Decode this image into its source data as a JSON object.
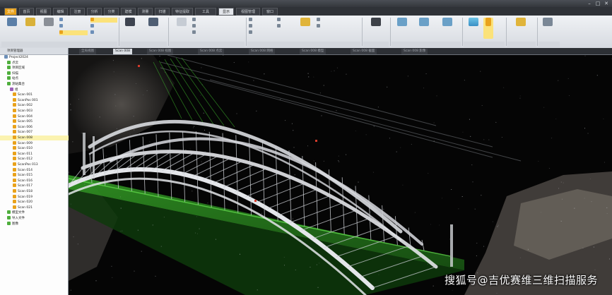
{
  "window": {
    "title": "",
    "controls": [
      "–",
      "□",
      "✕"
    ]
  },
  "ribbon_tabs": [
    {
      "label": "文件",
      "state": "file"
    },
    {
      "label": "首页",
      "state": "normal"
    },
    {
      "label": "视图",
      "state": "normal"
    },
    {
      "label": "编辑",
      "state": "normal"
    },
    {
      "label": "注册",
      "state": "normal"
    },
    {
      "label": "分析",
      "state": "normal"
    },
    {
      "label": "分类",
      "state": "normal"
    },
    {
      "label": "建模",
      "state": "normal"
    },
    {
      "label": "测量",
      "state": "normal"
    },
    {
      "label": "扫描",
      "state": "normal"
    },
    {
      "label": "特征提取",
      "state": "normal"
    },
    {
      "label": "工具",
      "state": "normal"
    },
    {
      "label": "显示",
      "state": "active"
    },
    {
      "label": "视图管理",
      "state": "normal"
    },
    {
      "label": "窗口",
      "state": "normal"
    }
  ],
  "tree": {
    "header": "项目管理器",
    "nodes": [
      {
        "label": "Project2024",
        "depth": 1,
        "selected": false
      },
      {
        "label": "点云",
        "depth": 2,
        "selected": false
      },
      {
        "label": "项目区域",
        "depth": 2,
        "selected": false
      },
      {
        "label": "扫描",
        "depth": 2,
        "selected": false
      },
      {
        "label": "站点",
        "depth": 2,
        "selected": false
      },
      {
        "label": "测站集合",
        "depth": 2,
        "selected": false
      },
      {
        "label": "组",
        "depth": 3,
        "selected": false
      },
      {
        "label": "Scan 001",
        "depth": 4,
        "selected": false
      },
      {
        "label": "ScanPos 001",
        "depth": 4,
        "selected": false
      },
      {
        "label": "Scan 002",
        "depth": 4,
        "selected": false
      },
      {
        "label": "Scan 003",
        "depth": 4,
        "selected": false
      },
      {
        "label": "Scan 004",
        "depth": 4,
        "selected": false
      },
      {
        "label": "Scan 005",
        "depth": 4,
        "selected": false
      },
      {
        "label": "Scan 006",
        "depth": 4,
        "selected": false
      },
      {
        "label": "Scan 007",
        "depth": 4,
        "selected": false
      },
      {
        "label": "Scan 008",
        "depth": 4,
        "selected": true
      },
      {
        "label": "Scan 009",
        "depth": 4,
        "selected": false
      },
      {
        "label": "Scan 010",
        "depth": 4,
        "selected": false
      },
      {
        "label": "Scan 011",
        "depth": 4,
        "selected": false
      },
      {
        "label": "Scan 012",
        "depth": 4,
        "selected": false
      },
      {
        "label": "ScanPos 013",
        "depth": 4,
        "selected": false
      },
      {
        "label": "Scan 014",
        "depth": 4,
        "selected": false
      },
      {
        "label": "Scan 015",
        "depth": 4,
        "selected": false
      },
      {
        "label": "Scan 016",
        "depth": 4,
        "selected": false
      },
      {
        "label": "Scan 017",
        "depth": 4,
        "selected": false
      },
      {
        "label": "Scan 018",
        "depth": 4,
        "selected": false
      },
      {
        "label": "Scan 019",
        "depth": 4,
        "selected": false
      },
      {
        "label": "Scan 020",
        "depth": 4,
        "selected": false
      },
      {
        "label": "Scan 021",
        "depth": 4,
        "selected": false
      },
      {
        "label": "模型文件",
        "depth": 2,
        "selected": false
      },
      {
        "label": "导入文件",
        "depth": 2,
        "selected": false
      },
      {
        "label": "图像",
        "depth": 2,
        "selected": false
      }
    ]
  },
  "view_tabs": [
    {
      "label": "全局视图",
      "active": false
    },
    {
      "label": "Scan 008",
      "active": true
    },
    {
      "label": "Scan 008 视图",
      "active": false
    },
    {
      "label": "Scan 008 点云",
      "active": false
    },
    {
      "label": "Scan 008 网格",
      "active": false
    },
    {
      "label": "Scan 008 模型",
      "active": false
    },
    {
      "label": "Scan 008 截面",
      "active": false
    },
    {
      "label": "Scan 008 影像",
      "active": false
    }
  ],
  "watermark": "搜狐号@吉优赛维三维扫描服务",
  "colors": {
    "file_tab": "#e9a21b",
    "tree_selection": "#fbf3b0",
    "point_green": "#39b82a",
    "arch_white": "#d9dbe0",
    "viewport_bg": "#050505"
  }
}
